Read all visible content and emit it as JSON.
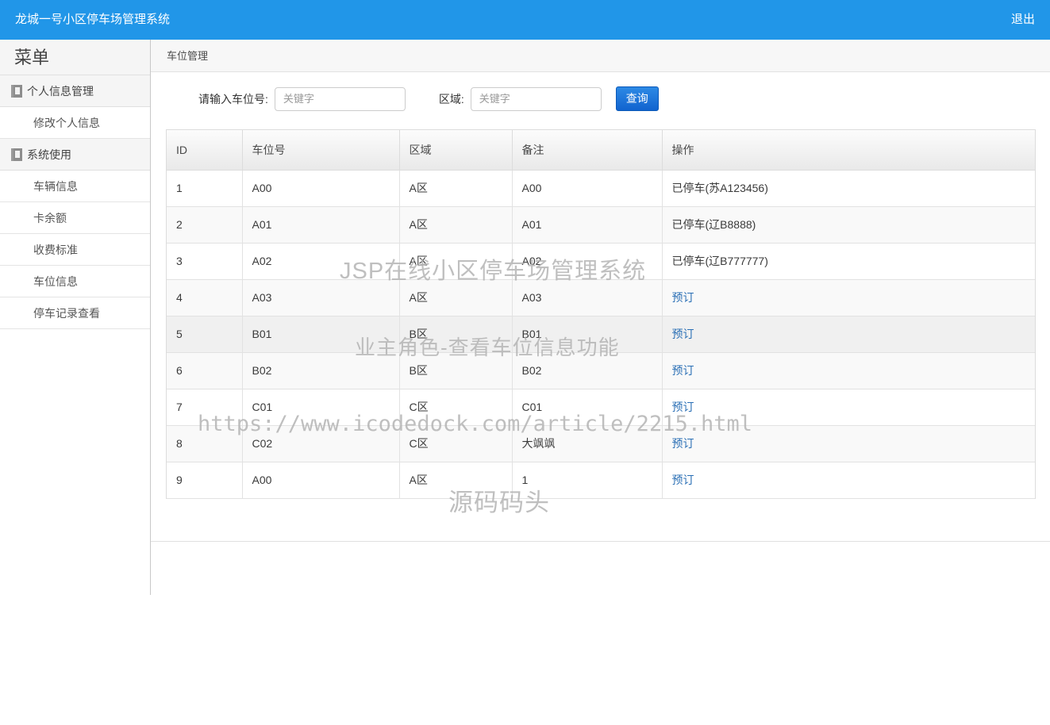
{
  "navbar": {
    "brand": "龙城一号小区停车场管理系统",
    "logout": "退出",
    "bg_color": "#2196e8"
  },
  "sidebar": {
    "title": "菜单",
    "groups": [
      {
        "label": "个人信息管理",
        "icon": "book-icon",
        "items": [
          {
            "label": "修改个人信息"
          }
        ]
      },
      {
        "label": "系统使用",
        "icon": "book-icon",
        "items": [
          {
            "label": "车辆信息"
          },
          {
            "label": "卡余额"
          },
          {
            "label": "收费标准"
          },
          {
            "label": "车位信息"
          },
          {
            "label": "停车记录查看"
          }
        ]
      }
    ]
  },
  "breadcrumb": "车位管理",
  "search": {
    "slot_label": "请输入车位号:",
    "slot_value": "",
    "slot_placeholder": "关键字",
    "area_label": "区域:",
    "area_value": "",
    "area_placeholder": "关键字",
    "button_label": "查询",
    "button_color": "#1163cf"
  },
  "table": {
    "columns": [
      "ID",
      "车位号",
      "区域",
      "备注",
      "操作"
    ],
    "rows": [
      {
        "id": "1",
        "slot": "A00",
        "area": "A区",
        "note": "A00",
        "op": "已停车(苏A123456)",
        "op_is_link": false
      },
      {
        "id": "2",
        "slot": "A01",
        "area": "A区",
        "note": "A01",
        "op": "已停车(辽B8888)",
        "op_is_link": false
      },
      {
        "id": "3",
        "slot": "A02",
        "area": "A区",
        "note": "A02",
        "op": "已停车(辽B777777)",
        "op_is_link": false
      },
      {
        "id": "4",
        "slot": "A03",
        "area": "A区",
        "note": "A03",
        "op": "预订",
        "op_is_link": true
      },
      {
        "id": "5",
        "slot": "B01",
        "area": "B区",
        "note": "B01",
        "op": "预订",
        "op_is_link": true
      },
      {
        "id": "6",
        "slot": "B02",
        "area": "B区",
        "note": "B02",
        "op": "预订",
        "op_is_link": true
      },
      {
        "id": "7",
        "slot": "C01",
        "area": "C区",
        "note": "C01",
        "op": "预订",
        "op_is_link": true
      },
      {
        "id": "8",
        "slot": "C02",
        "area": "C区",
        "note": "大飒飒",
        "op": "预订",
        "op_is_link": true
      },
      {
        "id": "9",
        "slot": "A00",
        "area": "A区",
        "note": "1",
        "op": "预订",
        "op_is_link": true
      }
    ]
  },
  "watermarks": {
    "title": "JSP在线小区停车场管理系统",
    "subtitle": "业主角色-查看车位信息功能",
    "url": "https://www.icodedock.com/article/2215.html",
    "brand": "源码码头"
  }
}
